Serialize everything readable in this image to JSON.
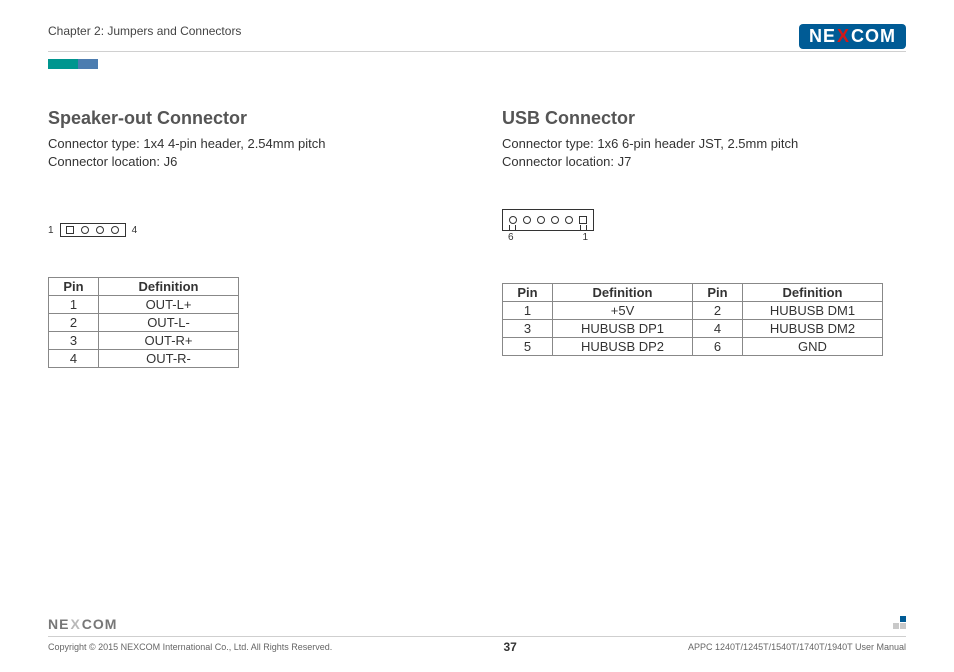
{
  "header": {
    "chapter": "Chapter 2: Jumpers and Connectors",
    "brand_left": "NE",
    "brand_x": "X",
    "brand_right": "COM"
  },
  "left": {
    "title": "Speaker-out Connector",
    "type": "Connector type: 1x4 4-pin header, 2.54mm pitch",
    "loc": "Connector location: J6",
    "diag_left": "1",
    "diag_right": "4",
    "headers": {
      "pin": "Pin",
      "def": "Definition"
    },
    "rows": [
      {
        "pin": "1",
        "def": "OUT-L+"
      },
      {
        "pin": "2",
        "def": "OUT-L-"
      },
      {
        "pin": "3",
        "def": "OUT-R+"
      },
      {
        "pin": "4",
        "def": "OUT-R-"
      }
    ]
  },
  "right": {
    "title": "USB Connector",
    "type": "Connector type: 1x6 6-pin header JST, 2.5mm pitch",
    "loc": "Connector location: J7",
    "diag_left": "6",
    "diag_right": "1",
    "headers": {
      "pin": "Pin",
      "def": "Definition"
    },
    "rows": [
      {
        "pin1": "1",
        "def1": "+5V",
        "pin2": "2",
        "def2": "HUBUSB DM1"
      },
      {
        "pin1": "3",
        "def1": "HUBUSB DP1",
        "pin2": "4",
        "def2": "HUBUSB DM2"
      },
      {
        "pin1": "5",
        "def1": "HUBUSB DP2",
        "pin2": "6",
        "def2": "GND"
      }
    ]
  },
  "footer": {
    "copyright": "Copyright © 2015 NEXCOM International Co., Ltd. All Rights Reserved.",
    "page": "37",
    "manual": "APPC 1240T/1245T/1540T/1740T/1940T User Manual"
  }
}
